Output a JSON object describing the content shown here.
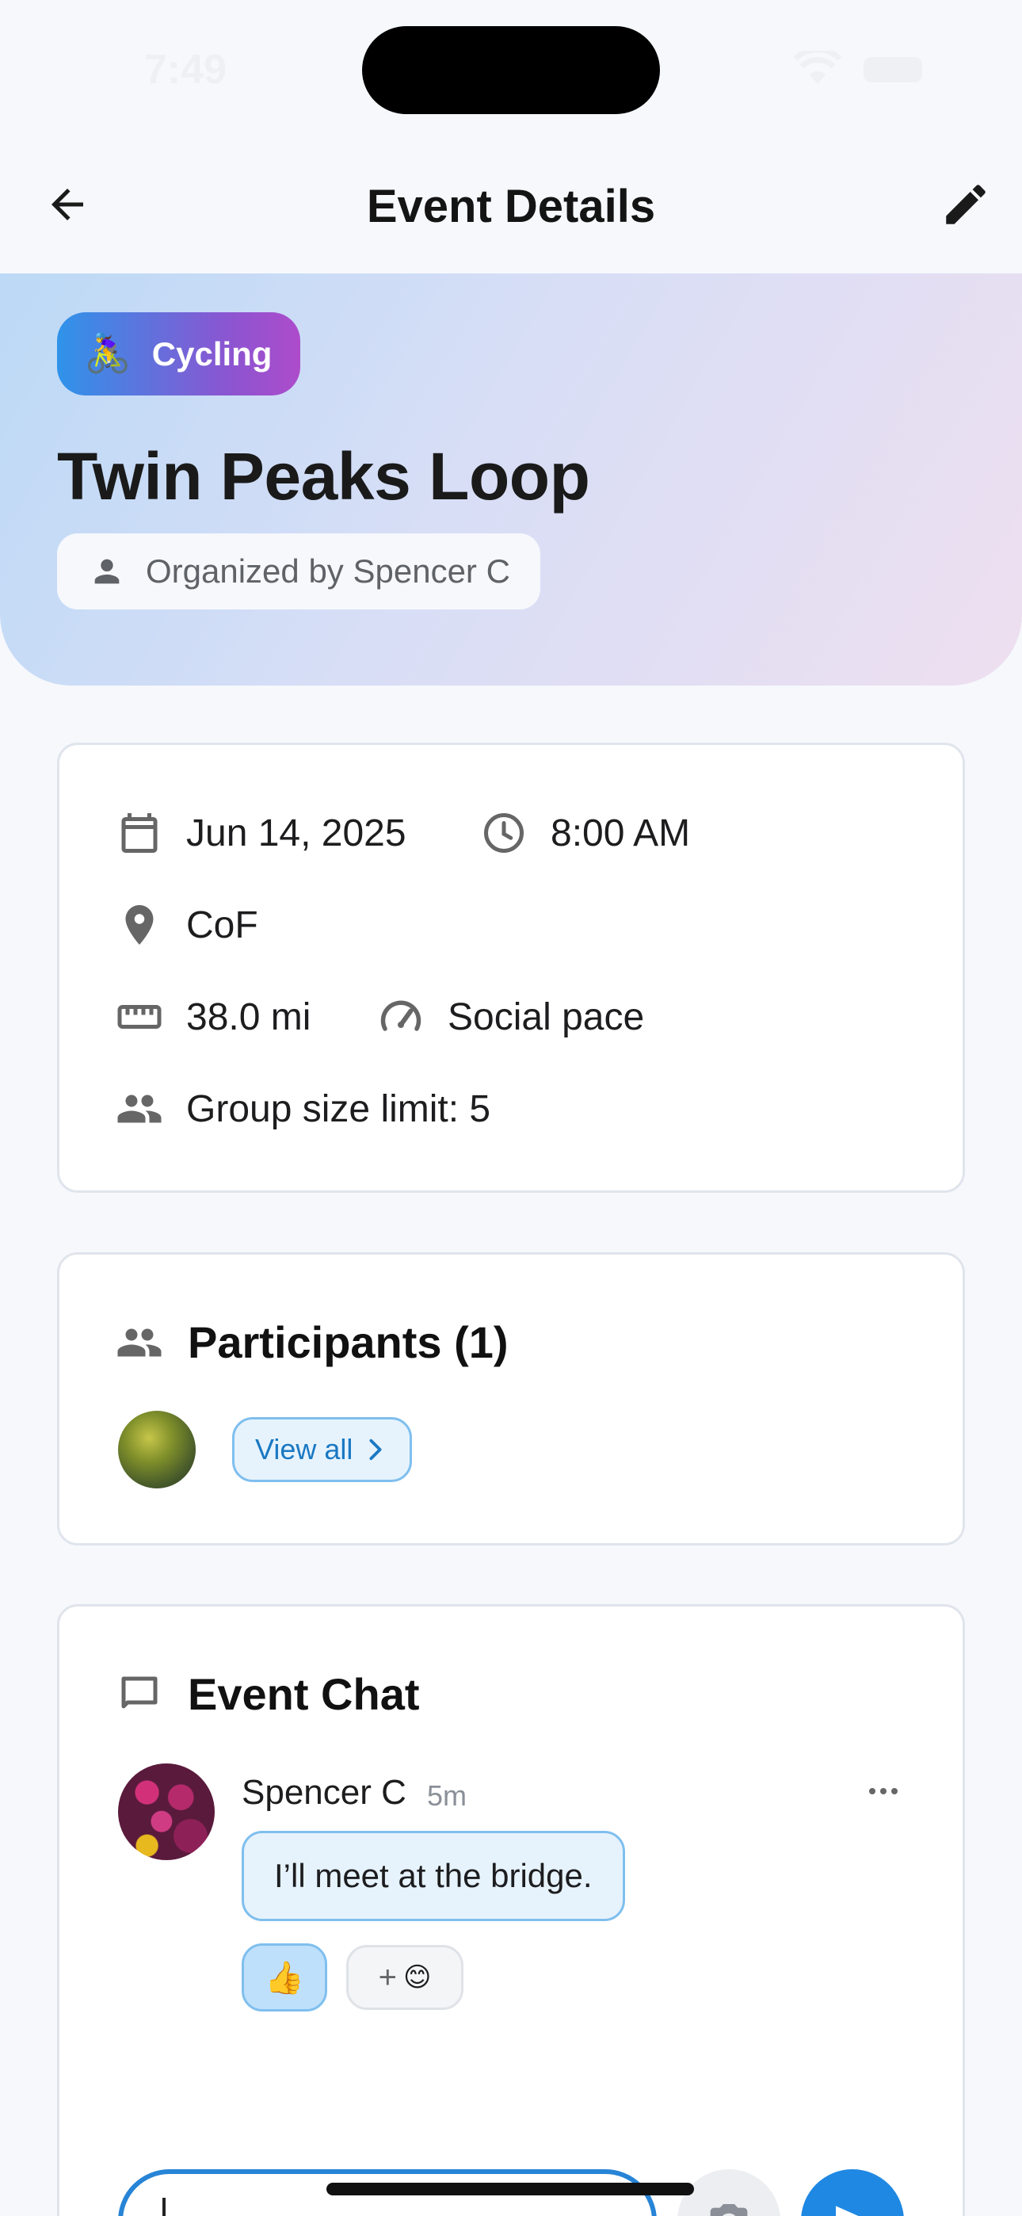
{
  "status_bar": {
    "time": "7:49"
  },
  "header": {
    "title": "Event Details"
  },
  "hero": {
    "category": {
      "emoji": "🚴‍♀️",
      "label": "Cycling"
    },
    "title": "Twin Peaks Loop",
    "organizer": "Organized by Spencer C"
  },
  "details": {
    "date": "Jun 14, 2025",
    "time": "8:00 AM",
    "location": "CoF",
    "distance": "38.0 mi",
    "pace": "Social pace",
    "group_limit": "Group size limit: 5"
  },
  "participants": {
    "heading": "Participants (1)",
    "view_all": "View all"
  },
  "chat": {
    "heading": "Event Chat",
    "messages": [
      {
        "author": "Spencer C",
        "time": "5m",
        "text": "I’ll meet at the bridge.",
        "reactions": [
          {
            "emoji": "👍"
          }
        ],
        "add_reaction_emoji": "😊"
      }
    ]
  },
  "colors": {
    "accent": "#1f88e3",
    "chip_gradient_start": "#2f93ea",
    "chip_gradient_end": "#ad4ccb",
    "hero_gradient_start": "#bcd9f6",
    "hero_gradient_end": "#eedff0"
  }
}
